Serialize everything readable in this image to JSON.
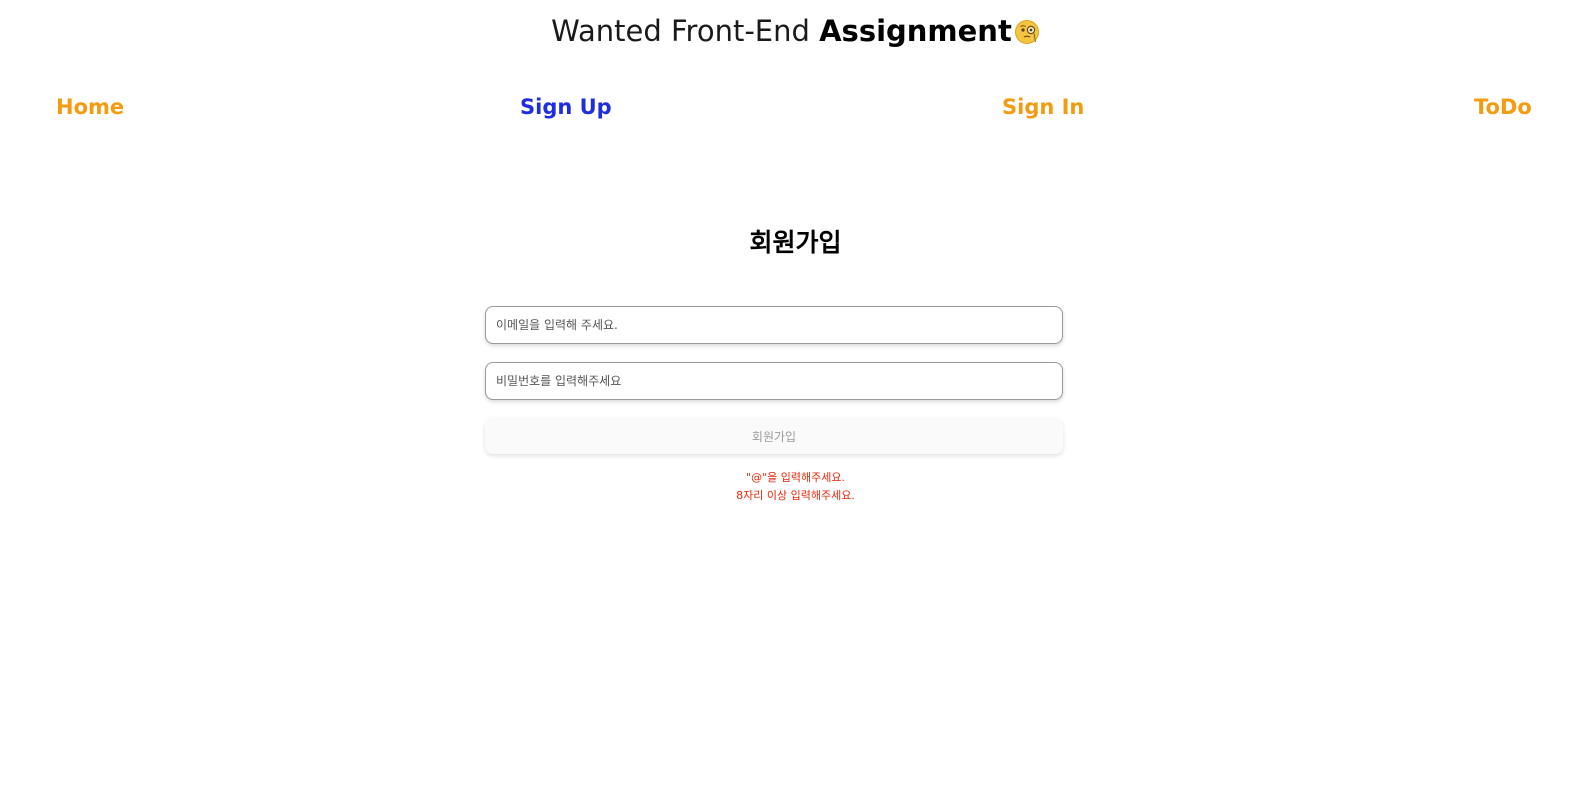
{
  "header": {
    "title_light": "Wanted Front-End ",
    "title_bold": "Assignment",
    "title_icon": "thinking-face-monocle-icon"
  },
  "nav": {
    "items": [
      {
        "label": "Home",
        "active": false
      },
      {
        "label": "Sign Up",
        "active": true
      },
      {
        "label": "Sign In",
        "active": false
      },
      {
        "label": "ToDo",
        "active": false
      }
    ],
    "colors": {
      "default": "#f39c12",
      "active": "#1f2de0"
    }
  },
  "main": {
    "heading": "회원가입",
    "email_field": {
      "value": "",
      "placeholder": "이메일을 입력해 주세요."
    },
    "password_field": {
      "value": "",
      "placeholder": "비밀번호를 입력해주세요"
    },
    "submit_label": "회원가입",
    "errors": {
      "email": "\"@\"을 입력해주세요.",
      "password": "8자리 이상 입력해주세요."
    },
    "error_color": "#e8290b"
  }
}
